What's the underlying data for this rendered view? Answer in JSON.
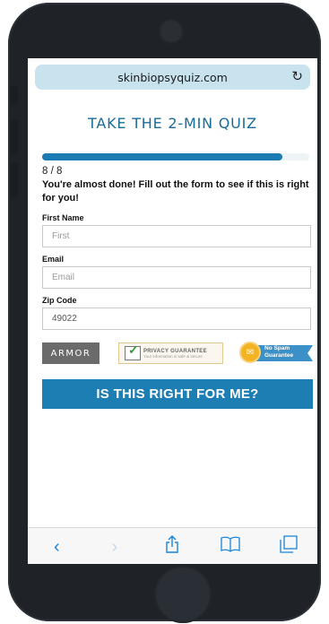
{
  "browser": {
    "url": "skinbiopsyquiz.com",
    "reload_icon": "reload-icon"
  },
  "quiz": {
    "title": "TAKE THE 2-MIN QUIZ",
    "progress": 1.0,
    "step": "8 / 8",
    "intro": "You're almost done! Fill out the form to see if this is right for you!"
  },
  "form": {
    "first_name": {
      "label": "First Name",
      "placeholder": "First",
      "value": ""
    },
    "email": {
      "label": "Email",
      "placeholder": "Email",
      "value": ""
    },
    "zip": {
      "label": "Zip Code",
      "placeholder": "",
      "value": "49022"
    }
  },
  "badges": {
    "armor": "ARMOR",
    "privacy_title": "PRIVACY GUARANTEE",
    "privacy_sub": "Your information is safe & secure",
    "spam": "No Spam Guarantee"
  },
  "cta": {
    "label": "IS THIS RIGHT FOR ME?"
  },
  "toolbar": {
    "icons": [
      "back-icon",
      "forward-icon",
      "share-icon",
      "bookmarks-icon",
      "tabs-icon"
    ]
  },
  "colors": {
    "accent": "#1d7eb3",
    "url_bar": "#c8e2ee",
    "phone": "#1f2328"
  }
}
